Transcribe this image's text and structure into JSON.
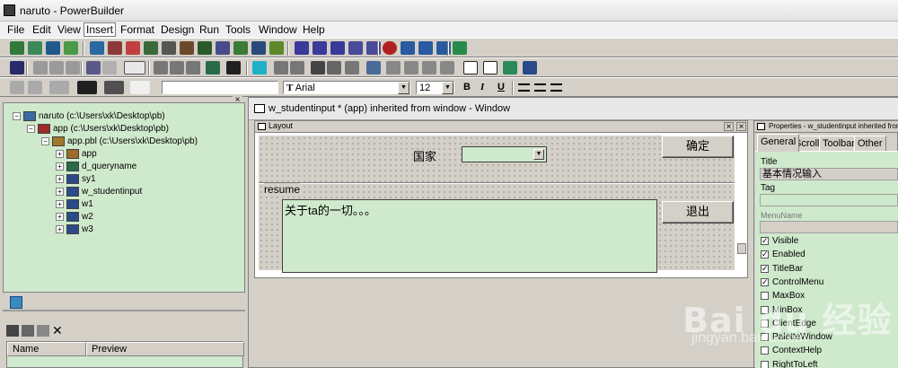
{
  "window": {
    "title": "naruto - PowerBuilder"
  },
  "menu": [
    "File",
    "Edit",
    "View",
    "Insert",
    "Format",
    "Design",
    "Run",
    "Tools",
    "Window",
    "Help"
  ],
  "format_bar": {
    "font": "Arial",
    "font_glyph": "T",
    "size": "12",
    "bold": "B",
    "italic": "I",
    "underline": "U"
  },
  "tree": {
    "items": [
      "naruto (c:\\Users\\xk\\Desktop\\pb)",
      "app (c:\\Users\\xk\\Desktop\\pb)",
      "app.pbl (c:\\Users\\xk\\Desktop\\pb)",
      "app",
      "d_queryname",
      "sy1",
      "w_studentinput",
      "w1",
      "w2",
      "w3"
    ]
  },
  "bottom_panel": {
    "col_name": "Name",
    "col_preview": "Preview"
  },
  "painter": {
    "title": "w_studentinput * (app) inherited from window - Window"
  },
  "layout": {
    "title": "Layout",
    "country_label": "国家",
    "confirm_button": "确定",
    "exit_button": "退出",
    "resume_label": "resume",
    "resume_text": "关于ta的一切。。。"
  },
  "properties": {
    "title": "Properties - w_studentinput inherited from",
    "tabs": [
      "General",
      "Scroll",
      "Toolbar",
      "Other"
    ],
    "title_label": "Title",
    "title_value": "基本情况输入",
    "tag_label": "Tag",
    "menuname_label": "MenuName",
    "checkboxes": [
      {
        "label": "Visible",
        "checked": true
      },
      {
        "label": "Enabled",
        "checked": true
      },
      {
        "label": "TitleBar",
        "checked": true
      },
      {
        "label": "ControlMenu",
        "checked": true
      },
      {
        "label": "MaxBox",
        "checked": false
      },
      {
        "label": "MinBox",
        "checked": false
      },
      {
        "label": "ClientEdge",
        "checked": false
      },
      {
        "label": "PaletteWindow",
        "checked": false
      },
      {
        "label": "ContextHelp",
        "checked": false
      },
      {
        "label": "RightToLeft",
        "checked": false
      }
    ]
  },
  "watermark": {
    "brand": "Bai du 经验",
    "url": "jingyan.baidu.com"
  }
}
